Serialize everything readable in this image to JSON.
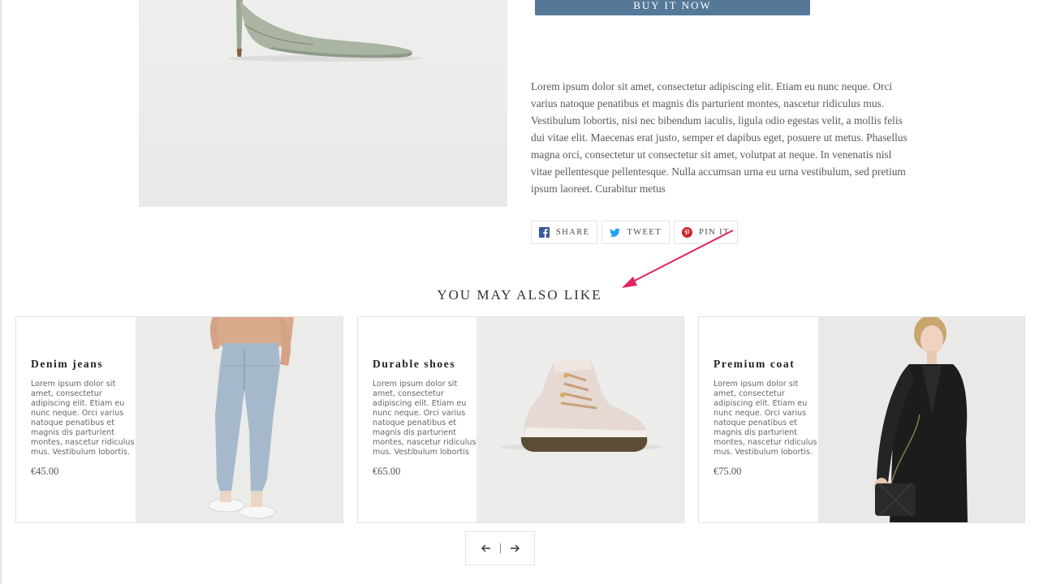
{
  "buy_button": {
    "label": "BUY IT NOW"
  },
  "description": "Lorem ipsum dolor sit amet, consectetur adipiscing elit. Etiam eu nunc neque. Orci varius natoque penatibus et magnis dis parturient montes, nascetur ridiculus mus. Vestibulum lobortis, nisi nec bibendum iaculis, ligula odio egestas velit, a mollis felis dui vitae elit. Maecenas erat justo, semper et dapibus eget, posuere ut metus. Phasellus magna orci, consectetur ut consectetur sit amet, volutpat at neque. In venenatis nisl vitae pellentesque pellentesque. Nulla accumsan urna eu urna vestibulum, sed pretium ipsum laoreet. Curabitur metus",
  "share": {
    "facebook": {
      "label": "SHARE",
      "icon": "facebook-icon",
      "color": "#3b5998"
    },
    "twitter": {
      "label": "TWEET",
      "icon": "twitter-icon",
      "color": "#1da1f2"
    },
    "pinterest": {
      "label": "PIN IT",
      "icon": "pinterest-icon",
      "color": "#cb2027"
    }
  },
  "related": {
    "title": "YOU MAY ALSO LIKE",
    "products": [
      {
        "name": "Denim jeans",
        "description": "Lorem ipsum dolor sit amet, consectetur adipiscing elit. Etiam eu nunc neque. Orci varius natoque penatibus et magnis dis parturient montes, nascetur ridiculus mus. Vestibulum lobortis.",
        "price": "€45.00"
      },
      {
        "name": "Durable shoes",
        "description": "Lorem ipsum dolor sit amet, consectetur adipiscing elit. Etiam eu nunc neque. Orci varius natoque penatibus et magnis dis parturient montes, nascetur ridiculus mus. Vestibulum lobortis",
        "price": "€65.00"
      },
      {
        "name": "Premium coat",
        "description": "Lorem ipsum dolor sit amet, consectetur adipiscing elit. Etiam eu nunc neque. Orci varius natoque penatibus et magnis dis parturient montes, nascetur ridiculus mus. Vestibulum lobortis.",
        "price": "€75.00"
      }
    ]
  },
  "pager": {
    "prev_icon": "arrow-left-icon",
    "next_icon": "arrow-right-icon"
  },
  "colors": {
    "button": "#557898",
    "annotation": "#e0245e"
  }
}
